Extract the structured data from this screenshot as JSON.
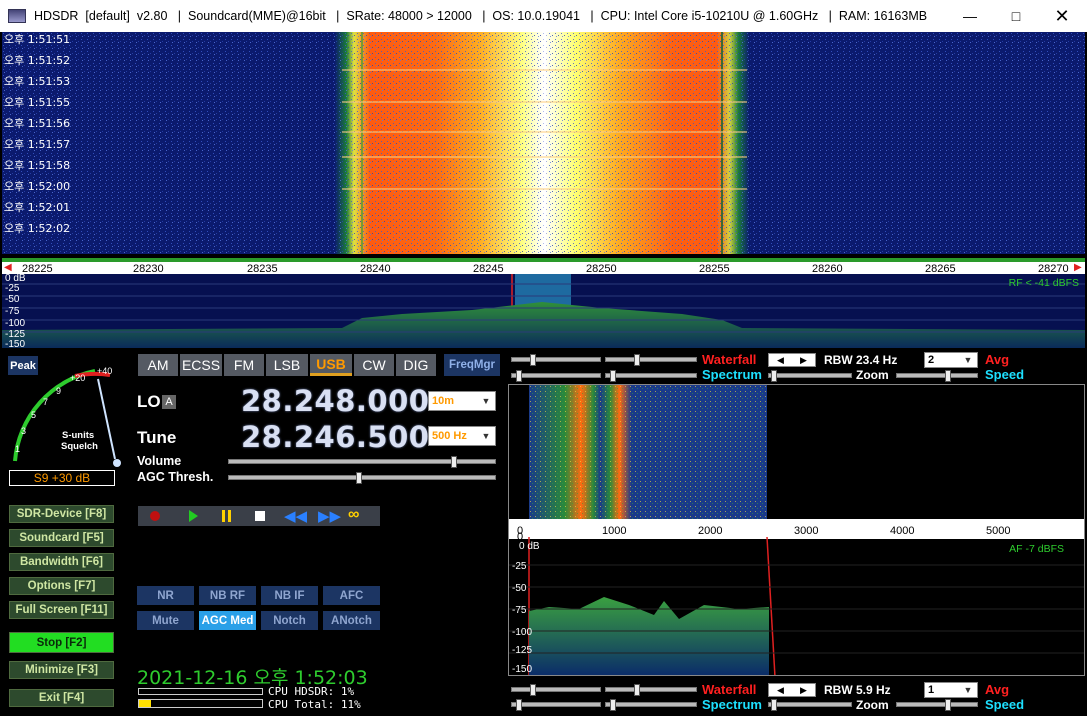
{
  "window": {
    "title": "HDSDR  [default]  v2.80   |  Soundcard(MME)@16bit   |  SRate: 48000 > 12000   |  OS: 10.0.19041   |  CPU: Intel Core i5-10210U @ 1.60GHz   |  RAM: 16163MB",
    "min_icon": "minimize-icon",
    "max_icon": "maximize-icon",
    "close_icon": "close-icon"
  },
  "waterfall": {
    "timestamps": [
      "오후 1:51:51",
      "오후 1:51:52",
      "오후 1:51:53",
      "오후 1:51:55",
      "오후 1:51:56",
      "오후 1:51:57",
      "오후 1:51:58",
      "오후 1:52:00",
      "오후 1:52:01",
      "오후 1:52:02"
    ]
  },
  "freq_scale": {
    "labels": [
      "28225",
      "28230",
      "28235",
      "28240",
      "28245",
      "28250",
      "28255",
      "28260",
      "28265",
      "28270"
    ]
  },
  "rf_spectrum": {
    "y_labels": [
      "0 dB",
      "-25",
      "-50",
      "-75",
      "-100",
      "-125",
      "-150"
    ],
    "level": "RF < -41 dBFS"
  },
  "smeter": {
    "peak_label": "Peak",
    "scale": [
      "1",
      "3",
      "5",
      "7",
      "9",
      "+20",
      "+40"
    ],
    "caption1": "S-units",
    "caption2": "Squelch",
    "reading": "S9 +30 dB"
  },
  "left_buttons": [
    {
      "label": "SDR-Device [F8]"
    },
    {
      "label": "Soundcard  [F5]"
    },
    {
      "label": "Bandwidth  [F6]"
    },
    {
      "label": "Options   [F7]"
    },
    {
      "label": "Full Screen [F11]"
    },
    {
      "label": "Stop       [F2]"
    },
    {
      "label": "Minimize  [F3]"
    },
    {
      "label": "Exit      [F4]"
    }
  ],
  "modes": [
    "AM",
    "ECSS",
    "FM",
    "LSB",
    "USB",
    "CW",
    "DIG"
  ],
  "active_mode": "USB",
  "freqmgr": "FreqMgr",
  "lo": {
    "label": "LO",
    "badge": "A",
    "value": "28.248.000",
    "band": "10m"
  },
  "tune": {
    "label": "Tune",
    "value": "28.246.500",
    "step": "500 Hz"
  },
  "volume_label": "Volume",
  "agc_label": "AGC Thresh.",
  "transport_icons": [
    "record-icon",
    "play-icon",
    "pause-icon",
    "stop-icon",
    "rewind-icon",
    "fast-forward-icon",
    "loop-icon"
  ],
  "dsp_buttons": [
    {
      "label": "NR",
      "active": false
    },
    {
      "label": "NB RF",
      "active": false
    },
    {
      "label": "NB IF",
      "active": false
    },
    {
      "label": "AFC",
      "active": false
    },
    {
      "label": "Mute",
      "active": false
    },
    {
      "label": "AGC Med",
      "active": true
    },
    {
      "label": "Notch",
      "active": false
    },
    {
      "label": "ANotch",
      "active": false
    }
  ],
  "clock": "2021-12-16 오후 1:52:03",
  "cpu": {
    "hdsdr": "CPU HDSDR: 1%",
    "total": "CPU Total: 11%"
  },
  "rf_controls": {
    "waterfall": "Waterfall",
    "spectrum": "Spectrum",
    "rbw": "RBW 23.4 Hz",
    "avg_value": "2",
    "avg": "Avg",
    "zoom": "Zoom",
    "speed": "Speed"
  },
  "af_scale": {
    "labels": [
      "0",
      "1000",
      "2000",
      "3000",
      "4000",
      "5000"
    ]
  },
  "af_spectrum": {
    "y_labels": [
      "0 dB",
      "-25",
      "-50",
      "-75",
      "-100",
      "-125",
      "-150"
    ],
    "level": "AF  -7 dBFS"
  },
  "af_controls": {
    "waterfall": "Waterfall",
    "spectrum": "Spectrum",
    "rbw": "RBW  5.9 Hz",
    "avg_value": "1",
    "avg": "Avg",
    "zoom": "Zoom",
    "speed": "Speed"
  },
  "colors": {
    "accent": "#ff9a00",
    "green_text": "#2ecc2e",
    "waterfall_bg": "#0b1a6e"
  }
}
